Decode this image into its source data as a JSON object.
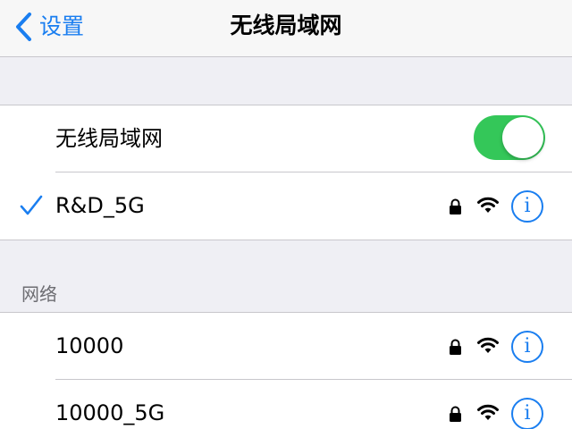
{
  "navbar": {
    "back_label": "设置",
    "title": "无线局域网"
  },
  "wifi_toggle": {
    "label": "无线局域网",
    "state": "on",
    "color": "#34c759"
  },
  "connected_network": {
    "name": "R&D_5G",
    "secured": true,
    "icons": [
      "checkmark-icon",
      "lock-icon",
      "wifi-icon",
      "info-icon"
    ]
  },
  "networks_section": {
    "header": "网络",
    "items": [
      {
        "name": "10000",
        "secured": true
      },
      {
        "name": "10000_5G",
        "secured": true
      }
    ]
  },
  "info_glyph": "i",
  "colors": {
    "accent": "#1a7ef0",
    "toggle_on": "#34c759",
    "background": "#efeff4"
  }
}
